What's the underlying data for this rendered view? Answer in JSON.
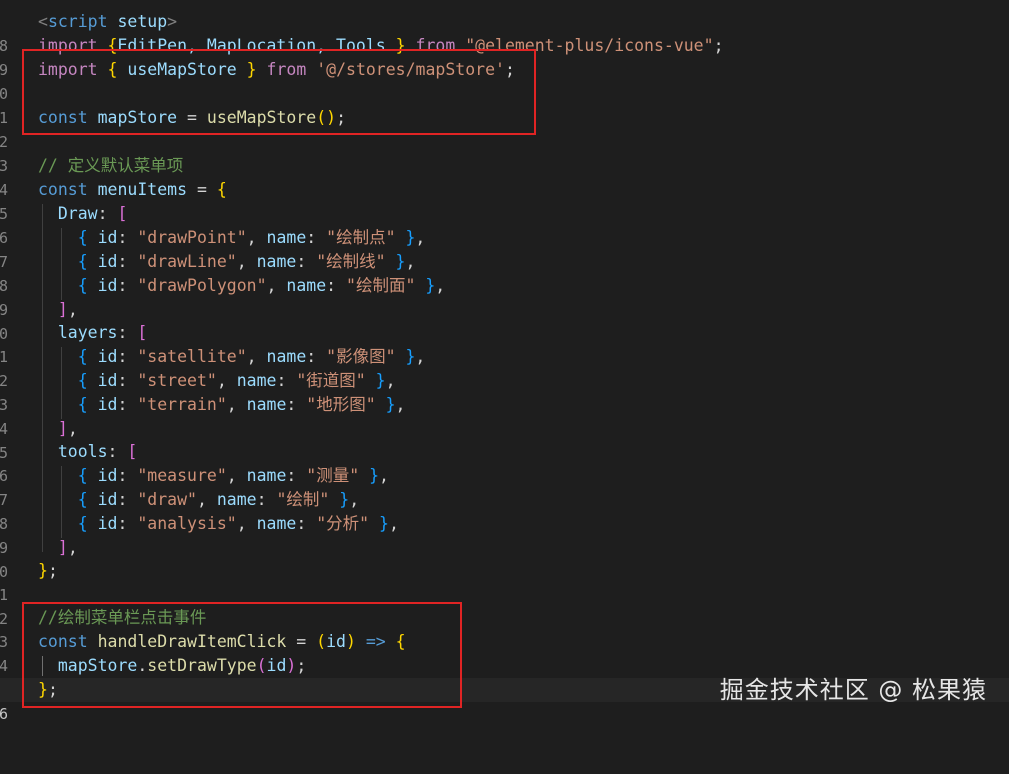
{
  "line_numbers": [
    "8",
    "9",
    "0",
    "1",
    "2",
    "3",
    "4",
    "5",
    "6",
    "7",
    "8",
    "9",
    "0",
    "1",
    "2",
    "3",
    "4",
    "5",
    "6",
    "7",
    "8",
    "9",
    "0",
    "1",
    "2",
    "3",
    "4",
    "5",
    "6"
  ],
  "code": {
    "l0": {
      "lt": "<",
      "tag": "script",
      "attr": "setup",
      "gt": ">"
    },
    "l1": {
      "kw": "import",
      "brace_open": "{",
      "names": "EditPen, MapLocation, Tools",
      "brace_close": "}",
      "from": "from",
      "src": "\"@element-plus/icons-vue\"",
      "semi": ";"
    },
    "l2": {
      "kw": "import",
      "brace_open": "{",
      "name": "useMapStore",
      "brace_close": "}",
      "from": "from",
      "src": "'@/stores/mapStore'",
      "semi": ";"
    },
    "l4": {
      "const": "const",
      "var": "mapStore",
      "eq": "=",
      "fn": "useMapStore",
      "call": "()",
      "semi": ";"
    },
    "l6": {
      "comment": "// 定义默认菜单项"
    },
    "l7": {
      "const": "const",
      "var": "menuItems",
      "eq": "=",
      "brace": "{"
    },
    "l8": {
      "key": "Draw",
      "colon": ":",
      "bracket": "["
    },
    "l9": {
      "open": "{",
      "id_key": "id",
      "sep1": ":",
      "id_val": "\"drawPoint\"",
      "comma1": ",",
      "name_key": "name",
      "sep2": ":",
      "name_val": "\"绘制点\"",
      "close": "}",
      "comma2": ","
    },
    "l10": {
      "open": "{",
      "id_key": "id",
      "sep1": ":",
      "id_val": "\"drawLine\"",
      "comma1": ",",
      "name_key": "name",
      "sep2": ":",
      "name_val": "\"绘制线\"",
      "close": "}",
      "comma2": ","
    },
    "l11": {
      "open": "{",
      "id_key": "id",
      "sep1": ":",
      "id_val": "\"drawPolygon\"",
      "comma1": ",",
      "name_key": "name",
      "sep2": ":",
      "name_val": "\"绘制面\"",
      "close": "}",
      "comma2": ","
    },
    "l12": {
      "bracket": "]",
      "comma": ","
    },
    "l13": {
      "key": "layers",
      "colon": ":",
      "bracket": "["
    },
    "l14": {
      "open": "{",
      "id_key": "id",
      "sep1": ":",
      "id_val": "\"satellite\"",
      "comma1": ",",
      "name_key": "name",
      "sep2": ":",
      "name_val": "\"影像图\"",
      "close": "}",
      "comma2": ","
    },
    "l15": {
      "open": "{",
      "id_key": "id",
      "sep1": ":",
      "id_val": "\"street\"",
      "comma1": ",",
      "name_key": "name",
      "sep2": ":",
      "name_val": "\"街道图\"",
      "close": "}",
      "comma2": ","
    },
    "l16": {
      "open": "{",
      "id_key": "id",
      "sep1": ":",
      "id_val": "\"terrain\"",
      "comma1": ",",
      "name_key": "name",
      "sep2": ":",
      "name_val": "\"地形图\"",
      "close": "}",
      "comma2": ","
    },
    "l17": {
      "bracket": "]",
      "comma": ","
    },
    "l18": {
      "key": "tools",
      "colon": ":",
      "bracket": "["
    },
    "l19": {
      "open": "{",
      "id_key": "id",
      "sep1": ":",
      "id_val": "\"measure\"",
      "comma1": ",",
      "name_key": "name",
      "sep2": ":",
      "name_val": "\"测量\"",
      "close": "}",
      "comma2": ","
    },
    "l20": {
      "open": "{",
      "id_key": "id",
      "sep1": ":",
      "id_val": "\"draw\"",
      "comma1": ",",
      "name_key": "name",
      "sep2": ":",
      "name_val": "\"绘制\"",
      "close": "}",
      "comma2": ","
    },
    "l21": {
      "open": "{",
      "id_key": "id",
      "sep1": ":",
      "id_val": "\"analysis\"",
      "comma1": ",",
      "name_key": "name",
      "sep2": ":",
      "name_val": "\"分析\"",
      "close": "}",
      "comma2": ","
    },
    "l22": {
      "bracket": "]",
      "comma": ","
    },
    "l23": {
      "brace": "}",
      "semi": ";"
    },
    "l25": {
      "comment": "//绘制菜单栏点击事件"
    },
    "l26": {
      "const": "const",
      "var": "handleDrawItemClick",
      "eq": "=",
      "paren_open": "(",
      "param": "id",
      "paren_close": ")",
      "arrow": "=>",
      "brace": "{"
    },
    "l27": {
      "obj": "mapStore",
      "dot": ".",
      "fn": "setDrawType",
      "paren_open": "(",
      "arg": "id",
      "paren_close": ")",
      "semi": ";"
    },
    "l28": {
      "brace": "}",
      "semi": ";"
    }
  },
  "watermark": "掘金技术社区 @ 松果猿",
  "colors": {
    "background": "#1e1e1e",
    "highlight_box": "#e02424",
    "keyword": "#569cd6",
    "variable": "#9cdcfe",
    "function": "#dcdcaa",
    "string": "#ce9178",
    "comment": "#6a9955"
  }
}
